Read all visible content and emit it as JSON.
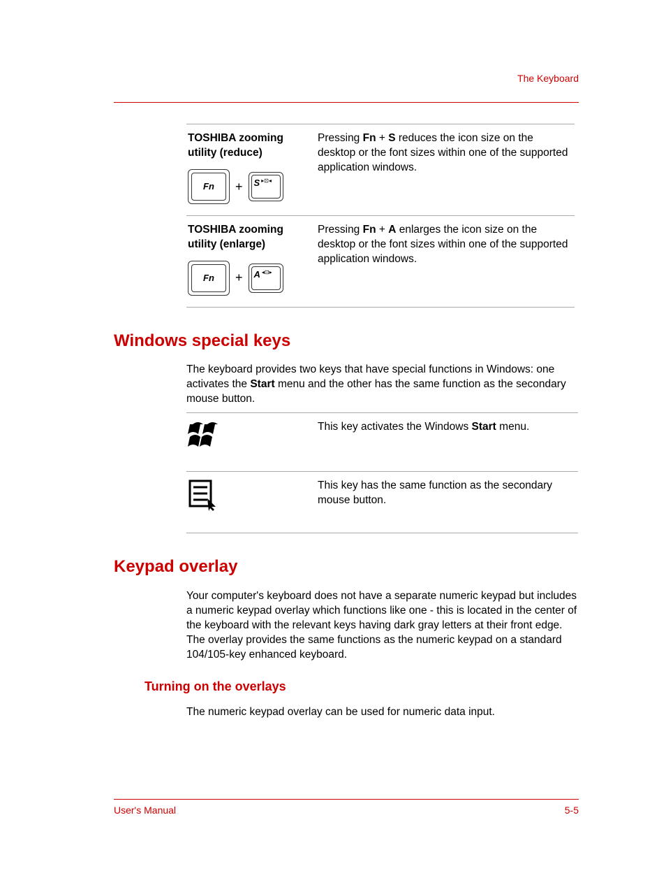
{
  "header": {
    "label": "The Keyboard"
  },
  "table1": {
    "rows": [
      {
        "title": "TOSHIBA zooming utility (reduce)",
        "fn_label": "Fn",
        "letter": "S",
        "desc_pre": "Pressing ",
        "k1": "Fn",
        "plus": " + ",
        "k2": "S",
        "desc_post": " reduces the icon size on the desktop or the font sizes within one of the supported application windows."
      },
      {
        "title": "TOSHIBA zooming utility (enlarge)",
        "fn_label": "Fn",
        "letter": "A",
        "desc_pre": "Pressing ",
        "k1": "Fn",
        "plus": " + ",
        "k2": "A",
        "desc_post": " enlarges the icon size on the desktop or the font sizes within one of the supported application windows."
      }
    ]
  },
  "windows_section": {
    "heading": "Windows special keys",
    "intro_pre": "The keyboard provides two keys that have special functions in Windows: one activates the ",
    "intro_bold": "Start",
    "intro_post": " menu and the other has the same function as the secondary mouse button.",
    "row1_pre": "This key activates the Windows ",
    "row1_bold": "Start",
    "row1_post": " menu.",
    "row2": "This key has the same function as the secondary mouse button."
  },
  "keypad_section": {
    "heading": "Keypad overlay",
    "para": "Your computer's keyboard does not have a separate numeric keypad but includes a numeric keypad overlay which functions like one - this is located in the center of the keyboard with the relevant keys having dark gray letters at their front edge. The overlay provides the same functions as the numeric keypad on a standard 104/105-key enhanced keyboard.",
    "subheading": "Turning on the overlays",
    "subpara": "The numeric keypad overlay can be used for numeric data input."
  },
  "footer": {
    "left": "User's Manual",
    "right": "5-5"
  }
}
